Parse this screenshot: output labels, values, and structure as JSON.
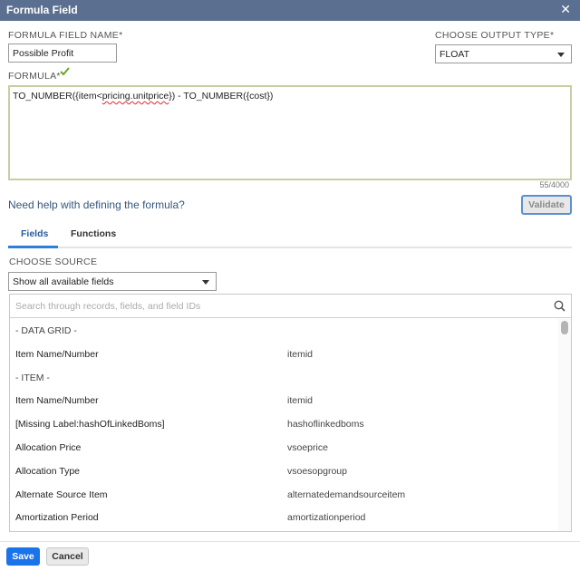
{
  "dialog": {
    "title": "Formula Field",
    "close_glyph": "✕"
  },
  "form": {
    "name_label": "FORMULA FIELD NAME*",
    "name_value": "Possible Profit",
    "output_label": "CHOOSE OUTPUT TYPE*",
    "output_value": "FLOAT",
    "formula_label": "FORMULA*",
    "formula_parts": [
      "TO_NUMBER({item<",
      "pricing.unitprice",
      "}) - TO_NUMBER({cost})"
    ],
    "char_count": "55/4000",
    "valid_icon": "check-icon",
    "valid_color": "#6aa52c"
  },
  "help": {
    "link_text": "Need help with defining the formula?",
    "validate_label": "Validate"
  },
  "tabs": [
    {
      "label": "Fields",
      "active": true
    },
    {
      "label": "Functions",
      "active": false
    }
  ],
  "source": {
    "label": "CHOOSE SOURCE",
    "select_value": "Show all available fields",
    "search_placeholder": "Search through records, fields, and field IDs"
  },
  "fields_list": [
    {
      "label": "- DATA GRID -",
      "id": ""
    },
    {
      "label": "Item Name/Number",
      "id": "itemid"
    },
    {
      "label": "- ITEM -",
      "id": ""
    },
    {
      "label": "Item Name/Number",
      "id": "itemid"
    },
    {
      "label": "[Missing Label:hashOfLinkedBoms]",
      "id": "hashoflinkedboms"
    },
    {
      "label": "Allocation Price",
      "id": "vsoeprice"
    },
    {
      "label": "Allocation Type",
      "id": "vsoesopgroup"
    },
    {
      "label": "Alternate Source Item",
      "id": "alternatedemandsourceitem"
    },
    {
      "label": "Amortization Period",
      "id": "amortizationperiod"
    }
  ],
  "footer": {
    "save_label": "Save",
    "cancel_label": "Cancel"
  },
  "colors": {
    "titlebar": "#5b6f90",
    "primary": "#1a73e8",
    "link": "#34577d",
    "active_tab": "#2f7fd8"
  }
}
